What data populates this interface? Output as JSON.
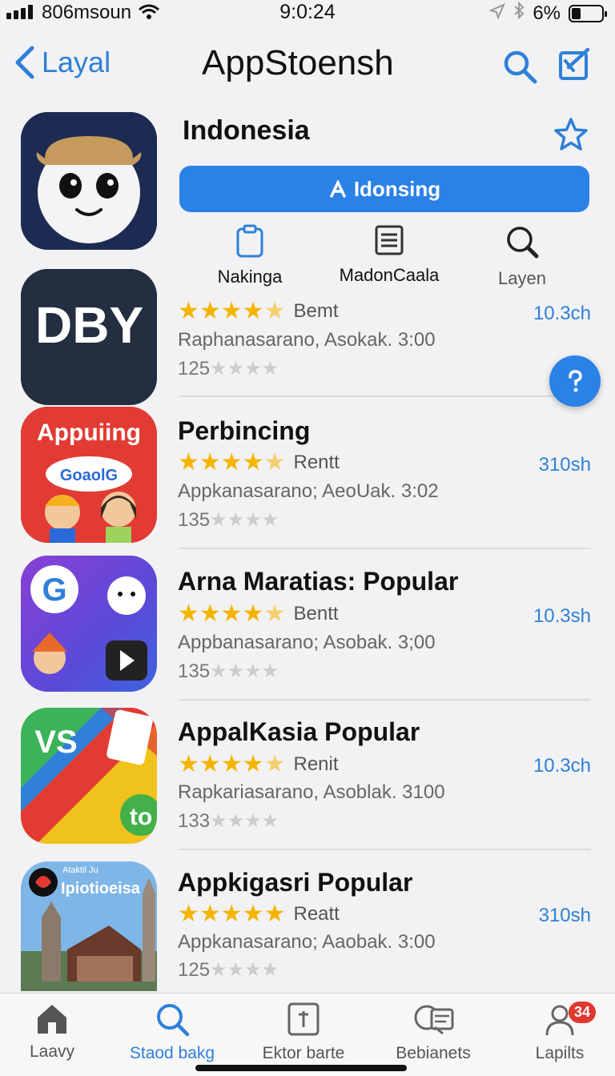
{
  "status": {
    "carrier": "806msoun",
    "time": "9:0:24",
    "battery": "6%",
    "battery_level": 0.3
  },
  "nav": {
    "back_label": "Layal",
    "title": "AppStoensh"
  },
  "featured": {
    "title": "Indonesia",
    "button_label": "Idonsing",
    "actions": [
      {
        "label": "Nakinga"
      },
      {
        "label": "MadonCaala"
      },
      {
        "label": "Layen"
      }
    ]
  },
  "apps": [
    {
      "icon_text": "DBY",
      "title": "",
      "rating_tag": "Bemt",
      "subtitle": "Raphanasarano, Asokak. 3:00",
      "count": "125",
      "size": "10.3ch",
      "stars": 4.5
    },
    {
      "icon_text": "Appuiing",
      "icon_badge": "GoaolG",
      "title": "Perbincing",
      "rating_tag": "Rentt",
      "subtitle": "Appkanasarano; AeoUak. 3:02",
      "count": "135",
      "size": "310sh",
      "stars": 4.5
    },
    {
      "icon_text": "G",
      "title": "Arna Maratias: Popular",
      "rating_tag": "Bentt",
      "subtitle": "Appbanasarano; Asobak. 3;00",
      "count": "135",
      "size": "10.3sh",
      "stars": 4.5
    },
    {
      "icon_text": "VS",
      "icon_badge": "to",
      "title": "AppalKasia Popular",
      "rating_tag": "Renit",
      "subtitle": "Rapkariasarano, Asoblak. 3100",
      "count": "133",
      "size": "10.3ch",
      "stars": 4.5
    },
    {
      "icon_text": "Ipiotioeisa",
      "icon_badge": "Ataktil Ju",
      "title": "Appkigasri Popular",
      "rating_tag": "Reatt",
      "subtitle": "Appkanasarano; Aaobak. 3:00",
      "count": "125",
      "size": "310sh",
      "stars": 5
    }
  ],
  "tabs": [
    {
      "label": "Laavy"
    },
    {
      "label": "Staod bakg"
    },
    {
      "label": "Ektor barte"
    },
    {
      "label": "Bebianets"
    },
    {
      "label": "Lapilts",
      "badge": "34"
    }
  ],
  "colors": {
    "accent": "#2b82e6",
    "star": "#f5b400",
    "badge": "#e0382e"
  }
}
